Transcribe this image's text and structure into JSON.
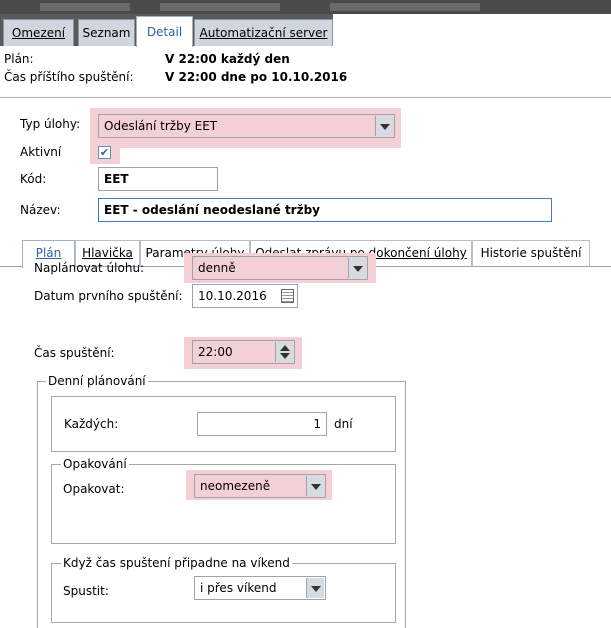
{
  "top_tabs": [
    "Omezení",
    "Seznam",
    "Detail",
    "Automatizační server"
  ],
  "info": {
    "plan_label": "Plán:",
    "plan_value": "V 22:00 každý den",
    "next_label": "Čas příštího spuštění:",
    "next_value": "V 22:00 dne po 10.10.2016"
  },
  "form": {
    "typ_label": "Typ úlohy:",
    "typ_value": "Odeslání tržby EET",
    "aktivni_label": "Aktivní",
    "aktivni_checked": true,
    "kod_label": "Kód:",
    "kod_value": "EET",
    "nazev_label": "Název:",
    "nazev_value": "EET - odeslání neodeslané tržby"
  },
  "sub_tabs": [
    "Plán",
    "Hlavička",
    "Parametry úlohy",
    "Odeslat zprávu po dokončení úlohy",
    "Historie spuštění"
  ],
  "plan": {
    "naplanovat_label": "Naplánovat úlohu:",
    "naplanovat_value": "denně",
    "datum_label": "Datum prvního spuštění:",
    "datum_value": "10.10.2016",
    "cas_label": "Čas spuštění:",
    "cas_value": "22:00",
    "denni_legend": "Denní plánování",
    "kazdych_label": "Každých:",
    "kazdych_value": "1",
    "kazdych_unit": "dní",
    "opakovani_legend": "Opakování",
    "opakovat_label": "Opakovat:",
    "opakovat_value": "neomezeně",
    "vikend_legend": "Když čas spuštení připadne na víkend",
    "spustit_label": "Spustit:",
    "spustit_value": "i přes víkend"
  },
  "colors": {
    "highlight": "#f3cfd6",
    "accent": "#2b5fa8",
    "tab_bg": "#cfd6e0"
  }
}
